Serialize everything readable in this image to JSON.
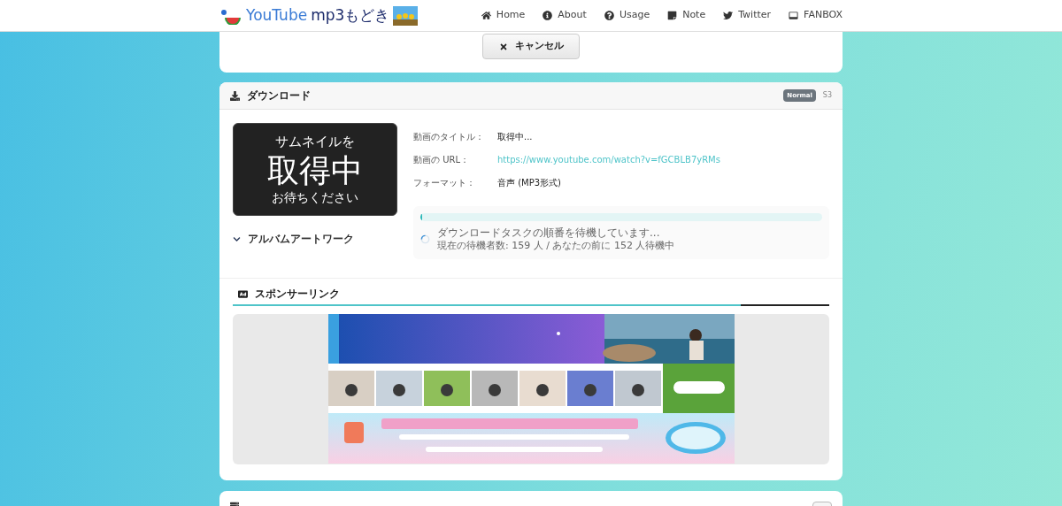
{
  "header": {
    "logo": {
      "part1": "YouTube",
      "part2": "mp3もどき"
    },
    "nav": [
      {
        "label": "Home"
      },
      {
        "label": "About"
      },
      {
        "label": "Usage"
      },
      {
        "label": "Note"
      },
      {
        "label": "Twitter"
      },
      {
        "label": "FANBOX"
      }
    ]
  },
  "cancel_button": {
    "label": "キャンセル"
  },
  "download": {
    "title": "ダウンロード",
    "badge": "Normal",
    "server": "S3",
    "thumbnail": {
      "line1": "サムネイルを",
      "line2": "取得中",
      "line3": "お待ちください"
    },
    "album_artwork": {
      "label": "アルバムアートワーク",
      "expanded": false
    },
    "fields": [
      {
        "label": "動画のタイトル：",
        "value": "取得中...",
        "kind": "text"
      },
      {
        "label": "動画の URL：",
        "value": "https://www.youtube.com/watch?v=fGCBLB7yRMs",
        "kind": "link"
      },
      {
        "label": "フォーマット：",
        "value": "音声 (MP3形式)",
        "kind": "text"
      }
    ],
    "progress": {
      "level": 0.005,
      "status": "ダウンロードタスクの順番を待機しています...",
      "queue": "現在の待機者数: 159 人 / あなたの前に 152 人待機中"
    }
  },
  "sponsor": {
    "title": "スポンサーリンク"
  }
}
